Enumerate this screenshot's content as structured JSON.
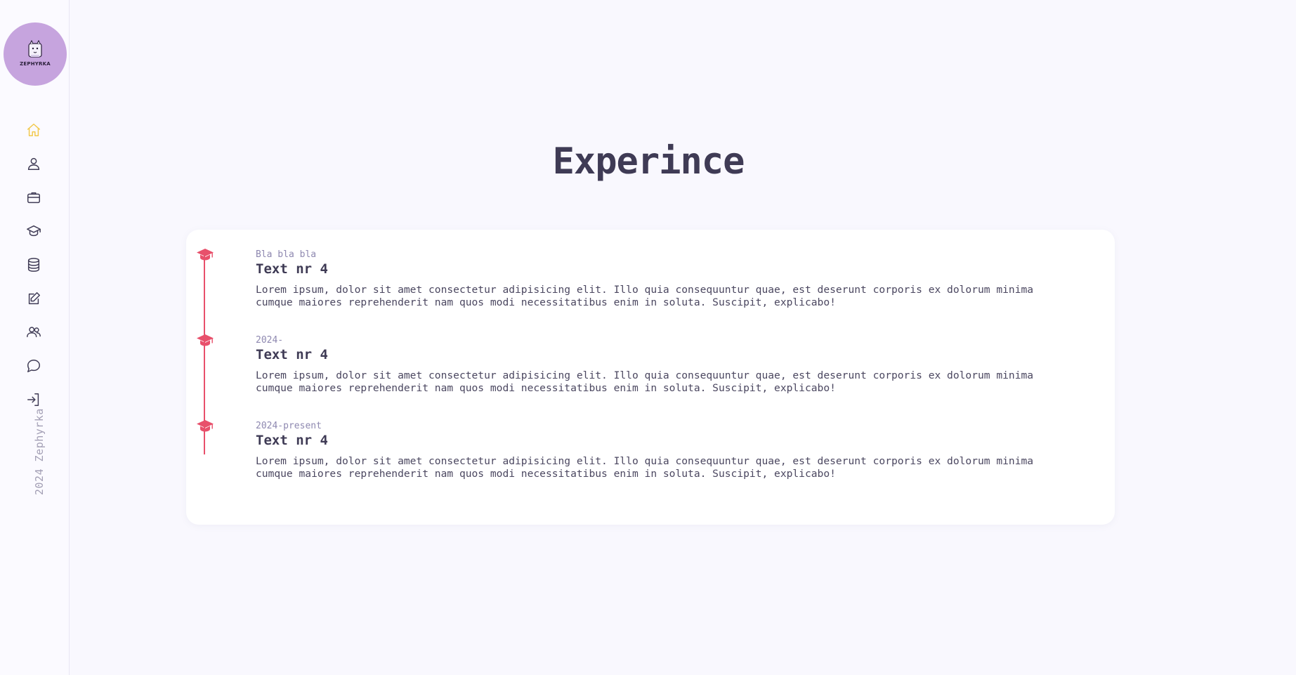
{
  "brand": {
    "logo_text": "ZEPHYRKA",
    "logo_bg": "#c6a4de"
  },
  "sidebar": {
    "items": [
      {
        "icon": "home-icon",
        "active": true
      },
      {
        "icon": "user-icon",
        "active": false
      },
      {
        "icon": "briefcase-icon",
        "active": false
      },
      {
        "icon": "graduation-cap-icon",
        "active": false
      },
      {
        "icon": "database-icon",
        "active": false
      },
      {
        "icon": "edit-icon",
        "active": false
      },
      {
        "icon": "users-icon",
        "active": false
      },
      {
        "icon": "chat-icon",
        "active": false
      },
      {
        "icon": "login-icon",
        "active": false
      }
    ],
    "footer": "2024 Zephyrka"
  },
  "colors": {
    "accent": "#f2c94c",
    "timeline": "#e8506b",
    "title": "#3f3b55",
    "date": "#8e88b0",
    "background": "#f9f8fe"
  },
  "main": {
    "title": "Experince",
    "entries": [
      {
        "date": "Bla bla bla",
        "title": "Text nr 4",
        "description": "Lorem ipsum, dolor sit amet consectetur adipisicing elit. Illo quia consequuntur quae, est deserunt corporis ex dolorum minima cumque maiores reprehenderit nam quos modi necessitatibus enim in soluta. Suscipit, explicabo!",
        "icon": "graduation-cap-icon"
      },
      {
        "date": "2024-",
        "title": "Text nr 4",
        "description": "Lorem ipsum, dolor sit amet consectetur adipisicing elit. Illo quia consequuntur quae, est deserunt corporis ex dolorum minima cumque maiores reprehenderit nam quos modi necessitatibus enim in soluta. Suscipit, explicabo!",
        "icon": "graduation-cap-icon"
      },
      {
        "date": "2024-present",
        "title": "Text nr 4",
        "description": "Lorem ipsum, dolor sit amet consectetur adipisicing elit. Illo quia consequuntur quae, est deserunt corporis ex dolorum minima cumque maiores reprehenderit nam quos modi necessitatibus enim in soluta. Suscipit, explicabo!",
        "icon": "graduation-cap-icon"
      }
    ]
  }
}
